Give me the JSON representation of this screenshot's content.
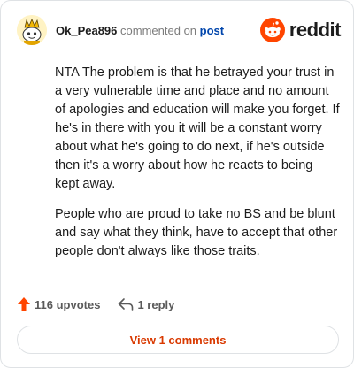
{
  "comment": {
    "username": "Ok_Pea896",
    "action_text": "commented on",
    "target_link": "post",
    "paragraphs": [
      "NTA The problem is that he betrayed your trust in a very vulnerable time and place and no amount of apologies and education will make you forget. If he's in there with you it will be a constant worry about what he's going to do next, if he's outside then it's a worry about how he reacts to being kept away.",
      "People who are proud to take no BS and be blunt and say what they think, have to accept that other people don't always like those traits."
    ],
    "upvotes_label": "116 upvotes",
    "reply_label": "1 reply",
    "view_comments_label": "View 1 comments"
  },
  "brand": {
    "wordmark": "reddit",
    "icon": "reddit-snoo-icon"
  },
  "icons": {
    "avatar": "snoo-avatar-icon",
    "upvote": "upvote-arrow-icon",
    "reply": "reply-arrow-icon"
  },
  "colors": {
    "brand_orange": "#ff4500",
    "upvote_orange": "#ff4500",
    "link_blue": "#0045ac",
    "view_button_text": "#d93900",
    "text_primary": "#1c1c1c",
    "text_secondary": "#7c7c7c",
    "border": "#dfe2e5"
  }
}
